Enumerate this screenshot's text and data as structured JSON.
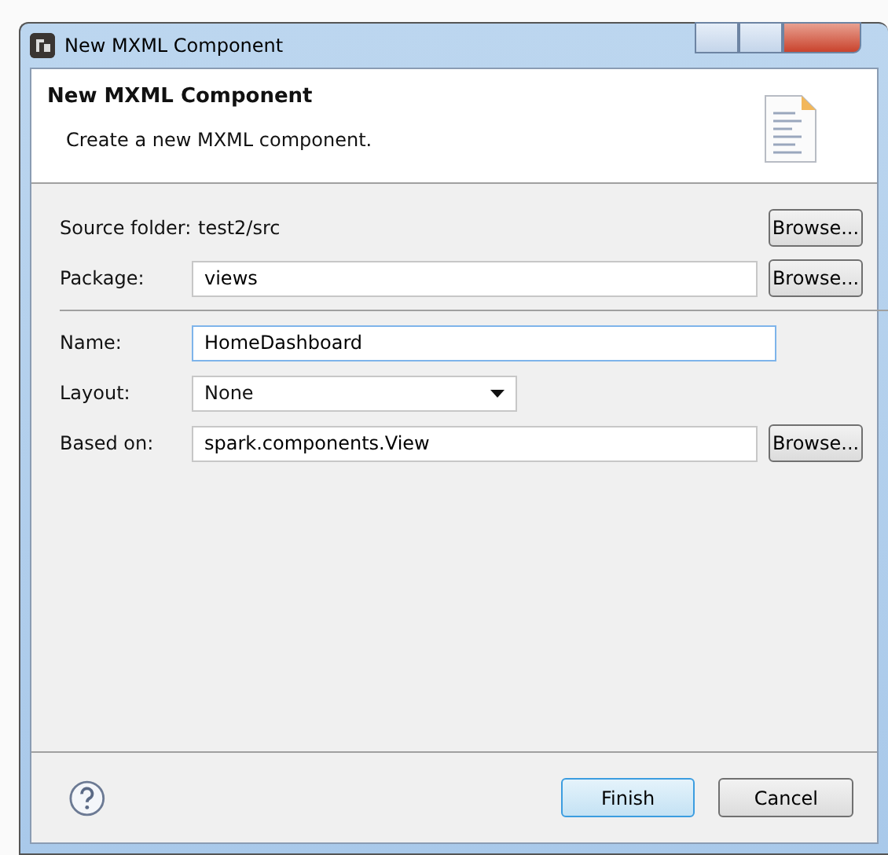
{
  "window": {
    "title": "New MXML Component"
  },
  "header": {
    "title": "New MXML Component",
    "description": "Create a new MXML component."
  },
  "fields": [
    {
      "kind": "static",
      "label": "Source folder:",
      "value": "test2/src",
      "button": "Browse..."
    },
    {
      "kind": "text",
      "label": "Package:",
      "value": "views",
      "button": "Browse...",
      "focused": false
    },
    {
      "kind": "separator"
    },
    {
      "kind": "text",
      "label": "Name:",
      "value": "HomeDashboard",
      "focused": true
    },
    {
      "kind": "select",
      "label": "Layout:",
      "value": "None"
    },
    {
      "kind": "text",
      "label": "Based on:",
      "value": "spark.components.View",
      "button": "Browse...",
      "focused": false
    }
  ],
  "buttons": [
    {
      "label": "Finish",
      "default": true
    },
    {
      "label": "Cancel",
      "default": false
    }
  ]
}
